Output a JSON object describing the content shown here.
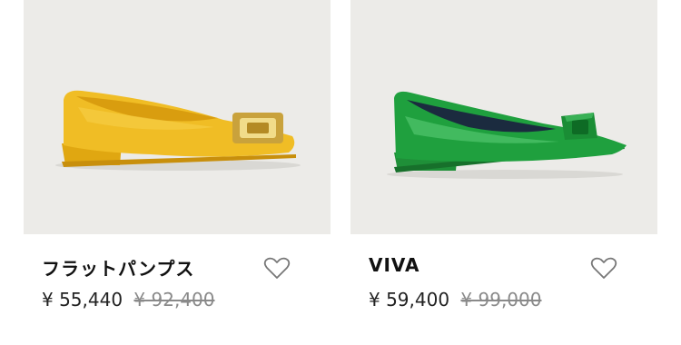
{
  "products": [
    {
      "name": "フラットパンプス",
      "price": "¥ 55,440",
      "original_price": "¥ 92,400",
      "favorite_icon": "heart-outline-icon",
      "color": "#f2c028"
    },
    {
      "name": "VIVA",
      "price": "¥ 59,400",
      "original_price": "¥ 99,000",
      "favorite_icon": "heart-outline-icon",
      "color": "#1e9e3a"
    }
  ]
}
